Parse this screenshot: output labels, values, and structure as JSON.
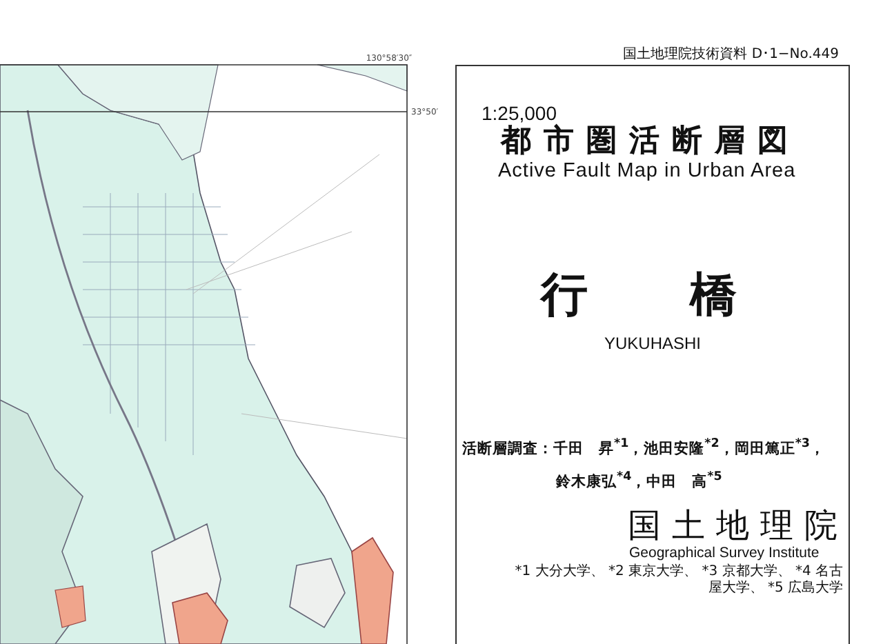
{
  "map": {
    "longitude_label": "130°58′30″",
    "latitude_label": "33°50′"
  },
  "header": {
    "series": "国土地理院技術資料 D･1−No.449"
  },
  "cover": {
    "scale": "1:25,000",
    "title": "都市圏活断層図",
    "title_en": "Active Fault Map in Urban Area",
    "place": "行　橋",
    "place_en": "YUKUHASHI",
    "investigators": [
      "活断層調査：千田　昇$^{*1}$，池田安隆$^{*2}$，岡田篤正$^{*3}$，",
      "鈴木康弘$^{*4}$，中田　高$^{*5}$"
    ],
    "publisher": "国土地理院",
    "publisher_en": "Geographical Survey Institute",
    "affiliations": "*1 大分大学、 *2 東京大学、 *3 京都大学、 *4 名古屋大学、 *5 広島大学"
  }
}
